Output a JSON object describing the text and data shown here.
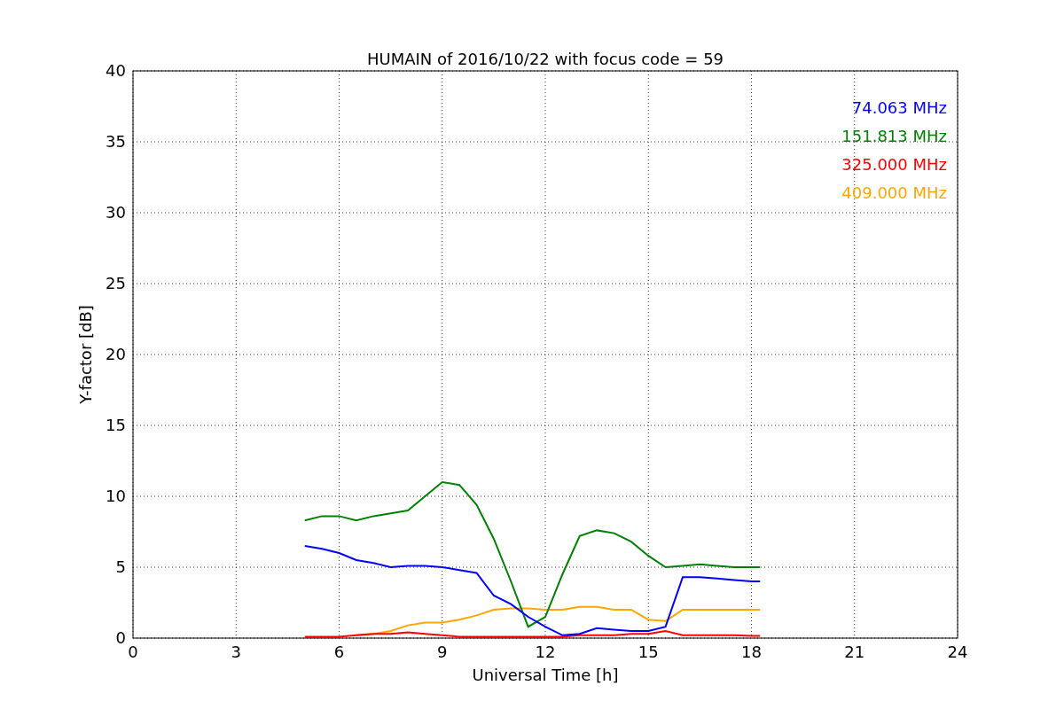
{
  "figure": {
    "chart_data": {
      "type": "line",
      "title": "HUMAIN of 2016/10/22 with focus code = 59",
      "xlabel": "Universal Time [h]",
      "ylabel": "Y-factor [dB]",
      "x": [
        5,
        5.5,
        6,
        6.5,
        7,
        7.5,
        8,
        8.5,
        9,
        9.5,
        10,
        10.5,
        11,
        11.5,
        12,
        12.5,
        13,
        13.5,
        14,
        14.5,
        15,
        15.5,
        16,
        16.5,
        17,
        17.5,
        18,
        18.25
      ],
      "series": [
        {
          "name": "74.063 MHz",
          "color": "#0000ff",
          "values": [
            6.5,
            6.3,
            6.0,
            5.5,
            5.3,
            5.0,
            5.1,
            5.1,
            5.0,
            4.8,
            4.6,
            3.0,
            2.4,
            1.5,
            0.8,
            0.2,
            0.3,
            0.7,
            0.6,
            0.5,
            0.5,
            0.8,
            4.3,
            4.3,
            4.2,
            4.1,
            4.0,
            4.0
          ]
        },
        {
          "name": "151.813 MHz",
          "color": "#008000",
          "values": [
            8.3,
            8.6,
            8.6,
            8.3,
            8.6,
            8.8,
            9.0,
            10.0,
            11.0,
            10.8,
            9.4,
            7.0,
            4.0,
            0.8,
            1.5,
            4.5,
            7.2,
            7.6,
            7.4,
            6.8,
            5.8,
            5.0,
            5.1,
            5.2,
            5.1,
            5.0,
            5.0,
            5.0
          ]
        },
        {
          "name": "325.000 MHz",
          "color": "#ff0000",
          "values": [
            0.1,
            0.1,
            0.1,
            0.2,
            0.3,
            0.3,
            0.4,
            0.3,
            0.2,
            0.1,
            0.1,
            0.1,
            0.1,
            0.1,
            0.1,
            0.1,
            0.2,
            0.2,
            0.2,
            0.3,
            0.3,
            0.5,
            0.2,
            0.2,
            0.2,
            0.2,
            0.15,
            0.15
          ]
        },
        {
          "name": "409.000 MHz",
          "color": "#ffa500",
          "values": [
            null,
            null,
            null,
            0.2,
            0.3,
            0.5,
            0.9,
            1.1,
            1.1,
            1.3,
            1.6,
            2.0,
            2.1,
            2.1,
            2.0,
            2.0,
            2.2,
            2.2,
            2.0,
            2.0,
            1.3,
            1.2,
            2.0,
            2.0,
            2.0,
            2.0,
            2.0,
            2.0
          ]
        }
      ],
      "grid": true,
      "xlim": [
        0,
        24
      ],
      "ylim": [
        0,
        40
      ],
      "xticks": [
        0,
        3,
        6,
        9,
        12,
        15,
        18,
        21,
        24
      ],
      "yticks": [
        0,
        5,
        10,
        15,
        20,
        25,
        30,
        35,
        40
      ]
    }
  }
}
